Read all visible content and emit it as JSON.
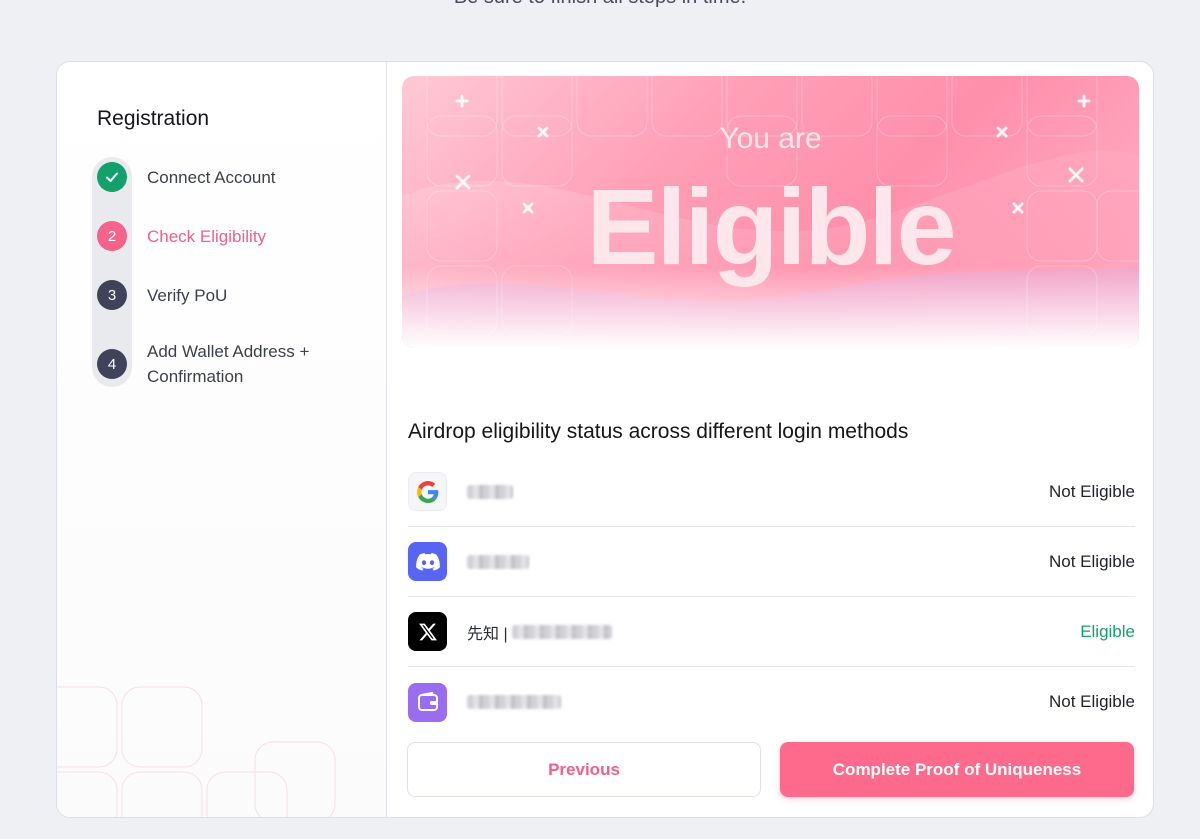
{
  "header": {
    "hint": "Be sure to finish all steps in time."
  },
  "sidebar": {
    "title": "Registration",
    "steps": [
      {
        "number": "",
        "label": "Connect Account",
        "state": "done"
      },
      {
        "number": "2",
        "label": "Check Eligibility",
        "state": "active"
      },
      {
        "number": "3",
        "label": "Verify PoU",
        "state": "todo"
      },
      {
        "number": "4",
        "label": "Add Wallet Address +",
        "label2": "Confirmation",
        "state": "todo"
      }
    ]
  },
  "banner": {
    "subtitle": "You are",
    "headline": "Eligible"
  },
  "eligibility": {
    "title": "Airdrop eligibility status across different login methods",
    "rows": [
      {
        "provider": "google-icon",
        "name": "",
        "status": "Not Eligible"
      },
      {
        "provider": "discord-icon",
        "name": "",
        "status": "Not Eligible"
      },
      {
        "provider": "x-icon",
        "name": "先知 | ",
        "status": "Eligible"
      },
      {
        "provider": "wallet-icon",
        "name": "",
        "status": "Not Eligible"
      }
    ]
  },
  "actions": {
    "previous": "Previous",
    "complete": "Complete Proof of Uniqueness"
  },
  "colors": {
    "accent": "#fe6a8c",
    "success": "#13a06a",
    "step_todo": "#3f4258",
    "discord": "#5865f2",
    "x": "#000000",
    "wallet": "#9a6df0"
  }
}
